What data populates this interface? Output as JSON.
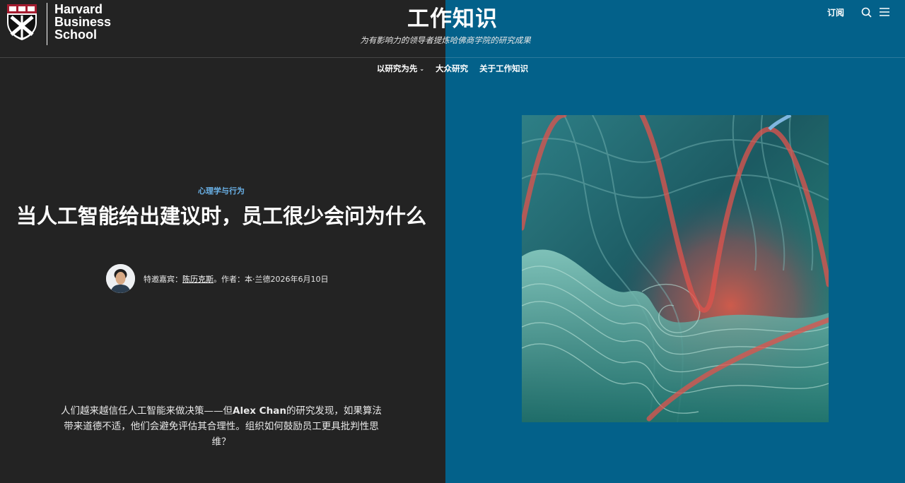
{
  "brand": {
    "logo_line1": "Harvard",
    "logo_line2": "Business",
    "logo_line3": "School"
  },
  "header": {
    "site_title": "工作知识",
    "tagline": "为有影响力的领导者提炼哈佛商学院的研究成果",
    "subscribe_label": "订阅",
    "icons": [
      "search-icon",
      "menu-icon"
    ]
  },
  "nav": {
    "items": [
      {
        "label": "以研究为先",
        "has_dropdown": true
      },
      {
        "label": "大众研究",
        "has_dropdown": false
      },
      {
        "label": "关于工作知识",
        "has_dropdown": false
      }
    ]
  },
  "article": {
    "category": "心理学与行为",
    "headline": "当人工智能给出建议时，员工很少会问为什么",
    "byline_prefix": "特邀嘉宾：",
    "byline_name": "陈历克斯",
    "byline_suffix": "。作者：本·兰德2026年6月10日",
    "dek_part1": "人们越来越信任人工智能来做决策——但",
    "dek_bold": "Alex Chan",
    "dek_part2": "的研究发现，如果算法带来道德不适，他们会避免评估其合理性。组织如何鼓励员工更具批判性思维？"
  },
  "colors": {
    "left_bg": "#232323",
    "right_bg": "#03618a",
    "category": "#6ab2e8"
  }
}
